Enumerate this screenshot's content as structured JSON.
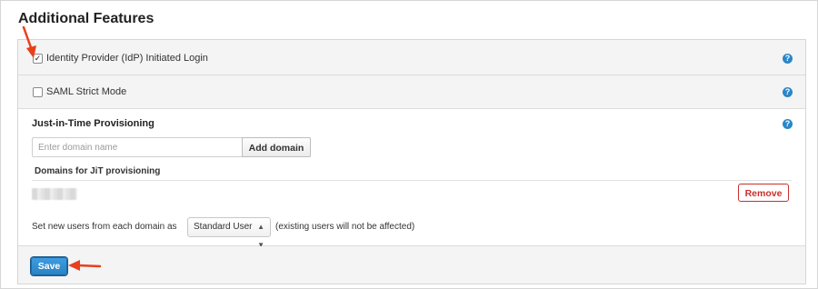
{
  "section_title": "Additional Features",
  "features": [
    {
      "label": "Identity Provider (IdP) Initiated Login",
      "checked": true,
      "help_icon": "question-circle-icon"
    },
    {
      "label": "SAML Strict Mode",
      "checked": false,
      "help_icon": "question-circle-icon"
    }
  ],
  "jit": {
    "title": "Just-in-Time Provisioning",
    "help_icon": "question-circle-icon",
    "domain_input": {
      "value": "",
      "placeholder": "Enter domain name"
    },
    "add_button_label": "Add domain",
    "domains_label": "Domains for JiT provisioning",
    "remove_label": "Remove",
    "role_prefix": "Set new users from each domain as",
    "role_selected": "Standard User",
    "role_suffix": "(existing users will not be affected)"
  },
  "footer": {
    "save_label": "Save"
  },
  "colors": {
    "accent": "#2a86c8",
    "danger": "#c9302c",
    "annotation_arrow": "#e8401c"
  }
}
